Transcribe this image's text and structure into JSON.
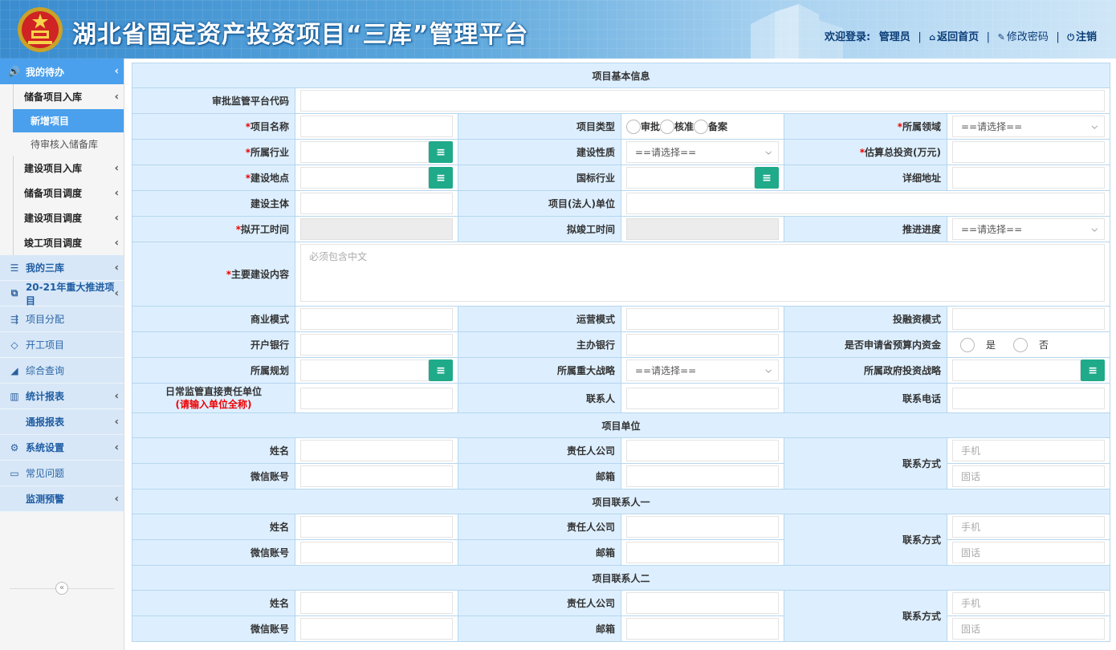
{
  "header": {
    "title": "湖北省固定资产投资项目“三库”管理平台",
    "welcome": "欢迎登录:",
    "username": "管理员",
    "home_link": "返回首页",
    "password_link": "修改密码",
    "logout_link": "注销"
  },
  "sidebar": {
    "top": {
      "label": "我的待办",
      "icon": "speaker-icon"
    },
    "sub1": {
      "label": "储备项目入库"
    },
    "sub1_items": [
      {
        "label": "新增项目",
        "active": true
      },
      {
        "label": "待审核入储备库",
        "active": false
      }
    ],
    "subs": [
      {
        "label": "建设项目入库"
      },
      {
        "label": "储备项目调度"
      },
      {
        "label": "建设项目调度"
      },
      {
        "label": "竣工项目调度"
      }
    ],
    "mains": [
      {
        "label": "我的三库",
        "icon": "list-icon",
        "chevron": true
      },
      {
        "label": "20-21年重大推进项目",
        "icon": "cubes-icon",
        "chevron": true
      },
      {
        "label": "项目分配",
        "icon": "distribute-icon",
        "chevron": false
      },
      {
        "label": "开工项目",
        "icon": "tag-icon",
        "chevron": false
      },
      {
        "label": "综合查询",
        "icon": "area-chart-icon",
        "chevron": false
      },
      {
        "label": "统计报表",
        "icon": "bar-chart-icon",
        "chevron": true
      },
      {
        "label": "通报报表",
        "icon": "",
        "chevron": true
      },
      {
        "label": "系统设置",
        "icon": "gear-icon",
        "chevron": true
      },
      {
        "label": "常见问题",
        "icon": "folder-icon",
        "chevron": false
      },
      {
        "label": "监测预警",
        "icon": "",
        "chevron": true
      }
    ]
  },
  "form": {
    "section_basic": "项目基本信息",
    "platform_code": "审批监管平台代码",
    "project_name": "项目名称",
    "project_type": "项目类型",
    "project_type_options": [
      "审批",
      "核准",
      "备案"
    ],
    "domain": "所属领域",
    "select_placeholder": "==请选择==",
    "industry": "所属行业",
    "build_nature": "建设性质",
    "est_investment": "估算总投资(万元)",
    "build_location": "建设地点",
    "intl_industry": "国标行业",
    "detail_address": "详细地址",
    "build_owner": "建设主体",
    "legal_unit": "项目(法人)单位",
    "planned_start": "拟开工时间",
    "planned_end": "拟竣工时间",
    "progress": "推进进度",
    "main_content": "主要建设内容",
    "main_content_placeholder": "必须包含中文",
    "business_model": "商业模式",
    "operation_model": "运营模式",
    "financing_model": "投融资模式",
    "bank": "开户银行",
    "lead_bank": "主办银行",
    "apply_budget": "是否申请省预算内资金",
    "yes": "是",
    "no": "否",
    "plan": "所属规划",
    "strategy": "所属重大战略",
    "gov_strategy": "所属政府投资战略",
    "supervisor_unit": "日常监管直接责任单位",
    "supervisor_unit_note": "(请输入单位全称)",
    "contact": "联系人",
    "contact_phone": "联系电话",
    "section_unit": "项目单位",
    "name": "姓名",
    "company": "责任人公司",
    "contact_method": "联系方式",
    "mobile_placeholder": "手机",
    "landline_placeholder": "固话",
    "wechat": "微信账号",
    "email": "邮箱",
    "section_contact1": "项目联系人一",
    "section_contact2": "项目联系人二"
  }
}
